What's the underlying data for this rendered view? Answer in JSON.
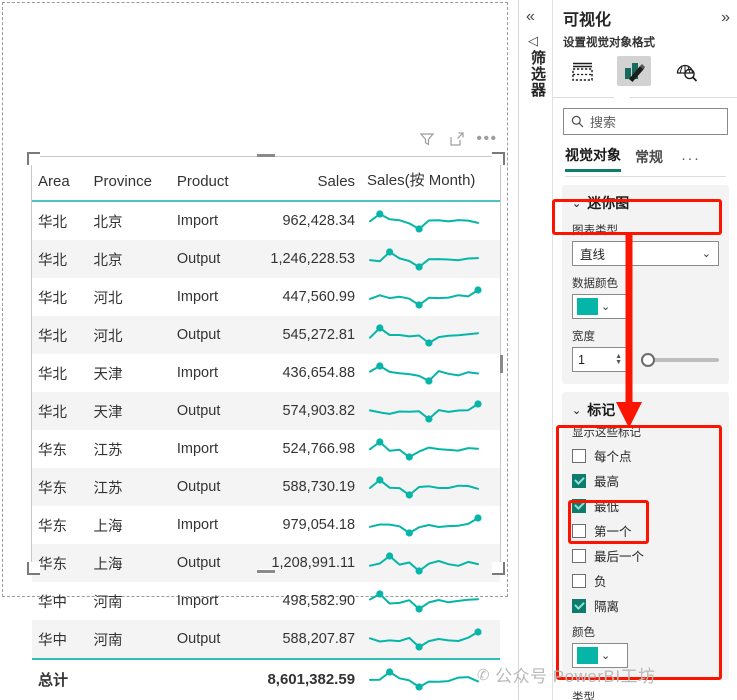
{
  "canvas": {
    "visual_toolbar": [
      {
        "name": "filter-icon",
        "label": "筛选器"
      },
      {
        "name": "focus-mode-icon",
        "label": "聚焦模式"
      },
      {
        "name": "more-options-icon",
        "label": "更多选项"
      }
    ]
  },
  "table": {
    "columns": [
      "Area",
      "Province",
      "Product",
      "Sales",
      "Sales(按 Month)"
    ],
    "rows": [
      {
        "area": "华北",
        "province": "北京",
        "product": "Import",
        "sales": "962,428.34"
      },
      {
        "area": "华北",
        "province": "北京",
        "product": "Output",
        "sales": "1,246,228.53"
      },
      {
        "area": "华北",
        "province": "河北",
        "product": "Import",
        "sales": "447,560.99"
      },
      {
        "area": "华北",
        "province": "河北",
        "product": "Output",
        "sales": "545,272.81"
      },
      {
        "area": "华北",
        "province": "天津",
        "product": "Import",
        "sales": "436,654.88"
      },
      {
        "area": "华北",
        "province": "天津",
        "product": "Output",
        "sales": "574,903.82"
      },
      {
        "area": "华东",
        "province": "江苏",
        "product": "Import",
        "sales": "524,766.98"
      },
      {
        "area": "华东",
        "province": "江苏",
        "product": "Output",
        "sales": "588,730.19"
      },
      {
        "area": "华东",
        "province": "上海",
        "product": "Import",
        "sales": "979,054.18"
      },
      {
        "area": "华东",
        "province": "上海",
        "product": "Output",
        "sales": "1,208,991.11"
      },
      {
        "area": "华中",
        "province": "河南",
        "product": "Import",
        "sales": "498,582.90"
      },
      {
        "area": "华中",
        "province": "河南",
        "product": "Output",
        "sales": "588,207.87"
      }
    ],
    "total": {
      "label": "总计",
      "sales": "8,601,382.59"
    }
  },
  "filters_rail": {
    "collapse_label": "«",
    "arrow_label": "◁",
    "title": "筛选器"
  },
  "viz_pane": {
    "title": "可视化",
    "expand_label": "»",
    "subtitle": "设置视觉对象格式",
    "icons": [
      {
        "name": "build-visual-icon",
        "label": "生成视觉对象"
      },
      {
        "name": "format-visual-icon",
        "label": "设置视觉对象格式"
      },
      {
        "name": "analytics-icon",
        "label": "分析"
      }
    ],
    "search": {
      "placeholder": "搜索",
      "value": ""
    },
    "tabs": [
      {
        "label": "视觉对象",
        "selected": true
      },
      {
        "label": "常规",
        "selected": false
      }
    ],
    "tabs_more": "···"
  },
  "sparkline_card": {
    "title": "迷你图",
    "chevron": "⌄",
    "chart_type": {
      "label": "图表类型",
      "value": "直线"
    },
    "data_color": {
      "label": "数据颜色",
      "value": "#05b6a8"
    },
    "width": {
      "label": "宽度",
      "value": "1",
      "slider_position": 0
    }
  },
  "markers_card": {
    "title": "标记",
    "chevron": "⌄",
    "section_label": "显示这些标记",
    "options": [
      {
        "label": "每个点",
        "checked": false
      },
      {
        "label": "最高",
        "checked": true
      },
      {
        "label": "最低",
        "checked": true
      },
      {
        "label": "第一个",
        "checked": false
      },
      {
        "label": "最后一个",
        "checked": false
      },
      {
        "label": "负",
        "checked": false
      },
      {
        "label": "隔离",
        "checked": true
      }
    ],
    "color": {
      "label": "颜色",
      "value": "#05b6a8"
    },
    "type_label": "类型"
  },
  "watermark": {
    "icon": "wechat-icon",
    "text": "公众号 PowerBI工坊"
  },
  "colors": {
    "teal": "#05b6a8",
    "header_rule": "#4fc3bd",
    "accent_green": "#0f7b6c",
    "annotation_red": "#fb1500",
    "alt_row": "#f4f4f4"
  }
}
